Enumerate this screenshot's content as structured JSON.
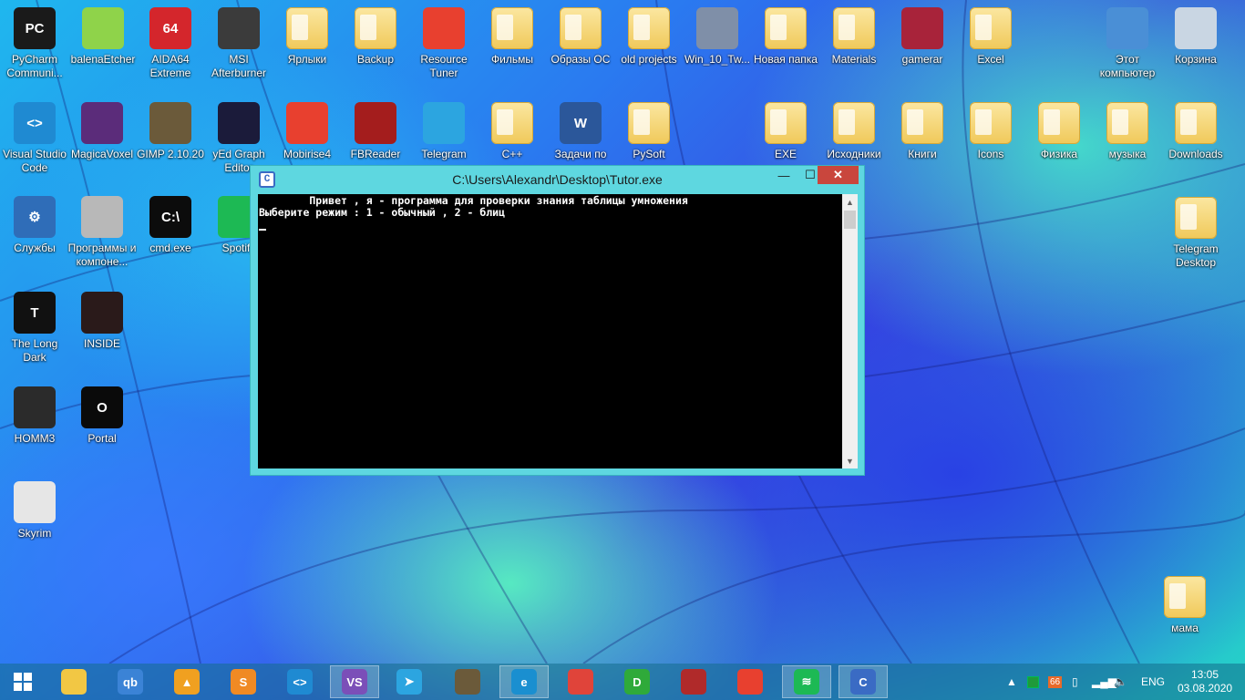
{
  "desktop": {
    "icons_row1": [
      {
        "label": "PyCharm Communi...",
        "icon": "pycharm-icon",
        "color": "#1a1a1a",
        "text": "PC"
      },
      {
        "label": "balenaEtcher",
        "icon": "balenaetcher-icon",
        "color": "#8fd34a",
        "text": ""
      },
      {
        "label": "AIDA64 Extreme",
        "icon": "aida64-icon",
        "color": "#d4262c",
        "text": "64"
      },
      {
        "label": "MSI Afterburner",
        "icon": "msi-afterburner-icon",
        "color": "#3b3b3b",
        "text": ""
      },
      {
        "label": "Ярлыки",
        "icon": "folder-icon",
        "color": "",
        "text": ""
      },
      {
        "label": "Backup",
        "icon": "folder-icon",
        "color": "",
        "text": ""
      },
      {
        "label": "Resource Tuner",
        "icon": "resource-tuner-icon",
        "color": "#e8402f",
        "text": ""
      },
      {
        "label": "Фильмы",
        "icon": "folder-icon",
        "color": "",
        "text": ""
      },
      {
        "label": "Образы ОС",
        "icon": "folder-icon",
        "color": "",
        "text": ""
      },
      {
        "label": "old projects",
        "icon": "folder-icon",
        "color": "",
        "text": ""
      },
      {
        "label": "Win_10_Tw...",
        "icon": "windows-logo-icon",
        "color": "#7f8fa8",
        "text": ""
      },
      {
        "label": "Новая папка",
        "icon": "folder-icon",
        "color": "",
        "text": ""
      },
      {
        "label": "Materials",
        "icon": "folder-icon",
        "color": "",
        "text": ""
      },
      {
        "label": "gamerar",
        "icon": "winrar-icon",
        "color": "#a8233a",
        "text": ""
      },
      {
        "label": "Excel",
        "icon": "folder-icon",
        "color": "",
        "text": ""
      }
    ],
    "icons_row2": [
      {
        "label": "Visual Studio Code",
        "icon": "vscode-icon",
        "color": "#1f8ad2",
        "text": "<>"
      },
      {
        "label": "MagicaVoxel",
        "icon": "magicavoxel-icon",
        "color": "#5b2c7a",
        "text": ""
      },
      {
        "label": "GIMP 2.10.20",
        "icon": "gimp-icon",
        "color": "#6b5a3a",
        "text": ""
      },
      {
        "label": "yEd Graph Editor",
        "icon": "yed-icon",
        "color": "#1b1b3a",
        "text": ""
      },
      {
        "label": "Mobirise4",
        "icon": "mobirise-icon",
        "color": "#e8402f",
        "text": ""
      },
      {
        "label": "FBReader",
        "icon": "fbreader-icon",
        "color": "#a41d1d",
        "text": ""
      },
      {
        "label": "Telegram",
        "icon": "telegram-icon",
        "color": "#2ca5e0",
        "text": ""
      },
      {
        "label": "C++",
        "icon": "folder-icon",
        "color": "",
        "text": ""
      },
      {
        "label": "Задачи по",
        "icon": "word-doc-icon",
        "color": "#2b579a",
        "text": "W"
      },
      {
        "label": "PySoft",
        "icon": "folder-icon",
        "color": "",
        "text": ""
      },
      {
        "label": "EXE",
        "icon": "folder-icon",
        "color": "",
        "text": ""
      },
      {
        "label": "Исходники",
        "icon": "folder-icon",
        "color": "",
        "text": ""
      },
      {
        "label": "Книги",
        "icon": "folder-icon",
        "color": "",
        "text": ""
      },
      {
        "label": "Icons",
        "icon": "folder-icon",
        "color": "",
        "text": ""
      },
      {
        "label": "Физика",
        "icon": "folder-icon",
        "color": "",
        "text": ""
      },
      {
        "label": "музыка",
        "icon": "folder-icon",
        "color": "",
        "text": ""
      },
      {
        "label": "Downloads",
        "icon": "folder-icon",
        "color": "",
        "text": ""
      }
    ],
    "icons_col1": [
      {
        "label": "Службы",
        "icon": "services-gear-icon",
        "color": "#2f6db8",
        "text": "⚙"
      },
      {
        "label": "The Long Dark",
        "icon": "the-long-dark-icon",
        "color": "#111111",
        "text": "T"
      },
      {
        "label": "HOMM3",
        "icon": "homm3-icon",
        "color": "#2b2b2b",
        "text": ""
      },
      {
        "label": "Skyrim",
        "icon": "skyrim-icon",
        "color": "#e6e6e6",
        "text": ""
      }
    ],
    "icons_col2": [
      {
        "label": "Программы и компоне...",
        "icon": "programs-features-icon",
        "color": "#b8b8b8",
        "text": ""
      },
      {
        "label": "INSIDE",
        "icon": "inside-game-icon",
        "color": "#2a1a1a",
        "text": ""
      },
      {
        "label": "Portal",
        "icon": "portal-icon",
        "color": "#0a0a0a",
        "text": "O"
      }
    ],
    "icons_col3": [
      {
        "label": "cmd.exe",
        "icon": "cmd-icon",
        "color": "#0c0c0c",
        "text": "C:\\"
      },
      {
        "label": "Spotify",
        "icon": "spotify-icon",
        "color": "#1db954",
        "text": ""
      }
    ],
    "icons_right": [
      {
        "label": "Этот компьютер",
        "icon": "this-pc-icon",
        "color": "#4a8fd6",
        "text": ""
      },
      {
        "label": "Корзина",
        "icon": "recycle-bin-icon",
        "color": "#c9d6e3",
        "text": ""
      },
      {
        "label": "Telegram Desktop",
        "icon": "folder-icon",
        "color": "",
        "text": ""
      },
      {
        "label": "мама",
        "icon": "folder-icon",
        "color": "",
        "text": ""
      }
    ]
  },
  "console_window": {
    "title": "C:\\Users\\Alexandr\\Desktop\\Tutor.exe",
    "icon": "c-console-icon",
    "minimize_label": "—",
    "maximize_label": "☐",
    "close_label": "✕",
    "lines": [
      "        Привет , я - программа для проверки знания таблицы умножения",
      "Выберите режим : 1 - обычный , 2 - блиц"
    ]
  },
  "taskbar": {
    "start_icon": "windows-start-icon",
    "apps": [
      {
        "name": "file-explorer-icon",
        "color": "#f2c744",
        "text": "",
        "active": false
      },
      {
        "name": "qbittorrent-icon",
        "color": "#3b83d6",
        "text": "qb",
        "active": false
      },
      {
        "name": "aimp-icon",
        "color": "#f0a020",
        "text": "▲",
        "active": false
      },
      {
        "name": "sublime-text-icon",
        "color": "#f08a24",
        "text": "S",
        "active": false
      },
      {
        "name": "vscode-icon",
        "color": "#1f8ad2",
        "text": "<>",
        "active": false
      },
      {
        "name": "visual-studio-icon",
        "color": "#7b4fb8",
        "text": "VS",
        "active": true
      },
      {
        "name": "telegram-icon",
        "color": "#2ca5e0",
        "text": "➤",
        "active": false
      },
      {
        "name": "gimp-icon",
        "color": "#6b5a3a",
        "text": "",
        "active": false
      },
      {
        "name": "edge-icon",
        "color": "#1a8fd0",
        "text": "e",
        "active": true
      },
      {
        "name": "chrome-icon",
        "color": "#e0443a",
        "text": "",
        "active": false
      },
      {
        "name": "d-app-icon",
        "color": "#2faa3a",
        "text": "D",
        "active": false
      },
      {
        "name": "book-app-icon",
        "color": "#b02a2a",
        "text": "",
        "active": false
      },
      {
        "name": "mobirise-icon",
        "color": "#e8402f",
        "text": "",
        "active": false
      },
      {
        "name": "spotify-icon",
        "color": "#1db954",
        "text": "≋",
        "active": true
      },
      {
        "name": "c-console-icon",
        "color": "#3a6bc4",
        "text": "C",
        "active": true
      }
    ],
    "tray": {
      "chevron": "▲",
      "badge": "66",
      "language": "ENG",
      "time": "13:05",
      "date": "03.08.2020"
    }
  }
}
